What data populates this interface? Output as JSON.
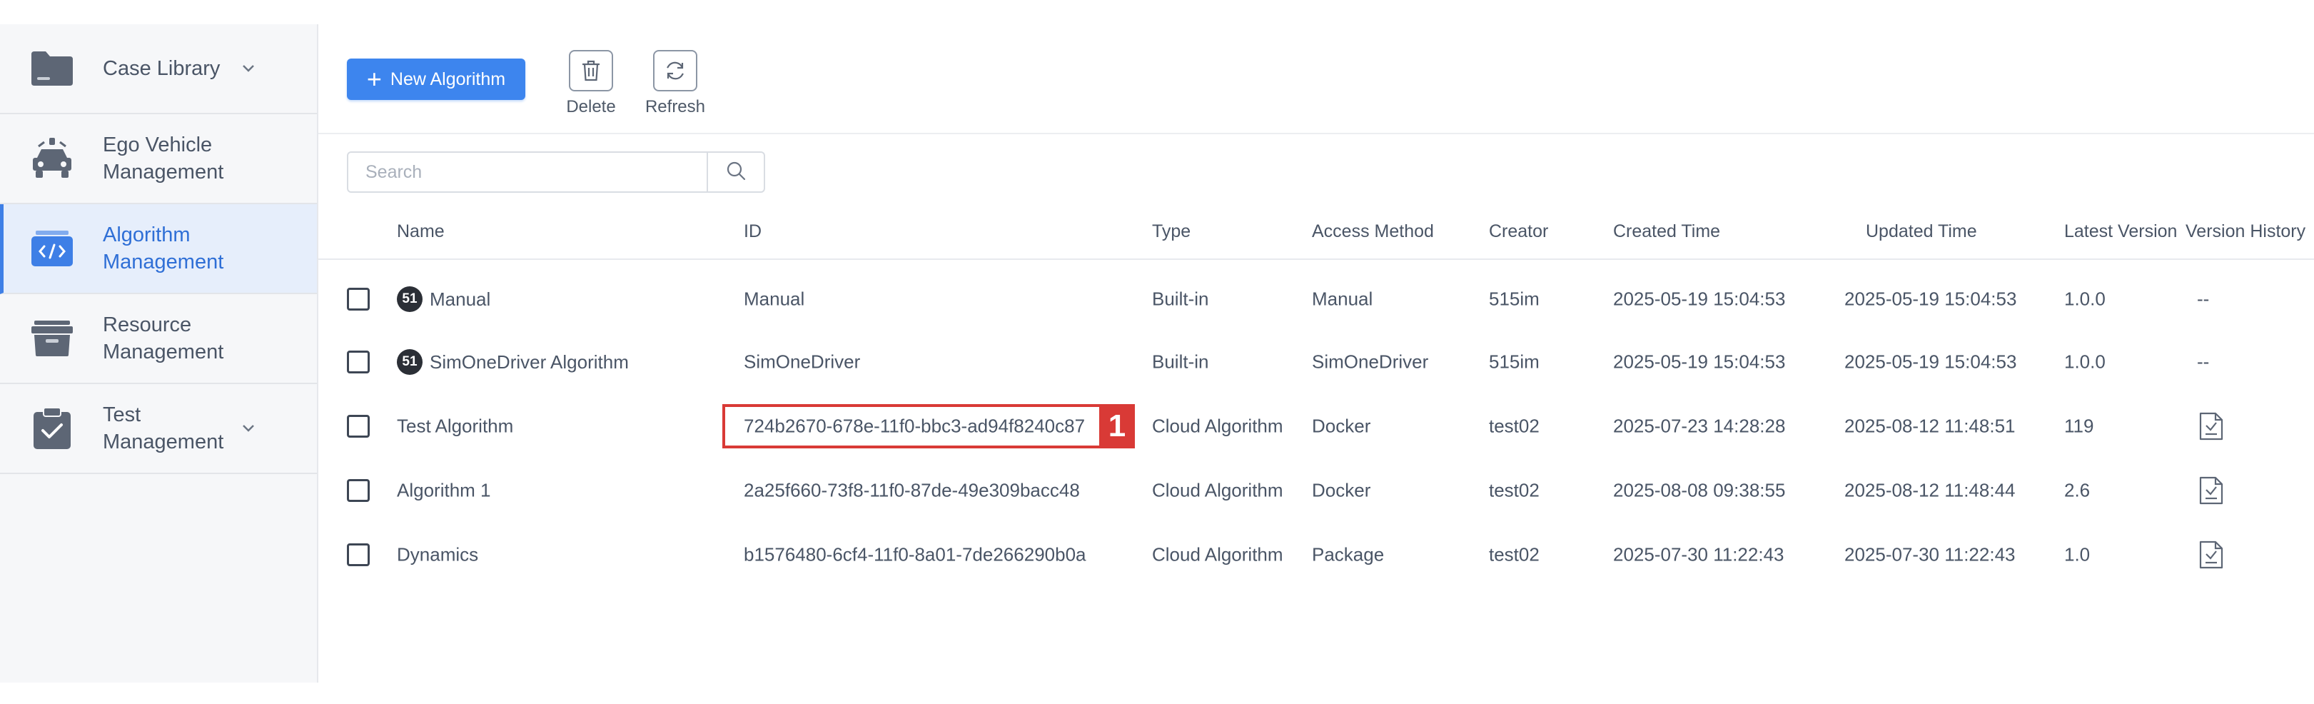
{
  "sidebar": {
    "items": [
      {
        "label": "Case Library",
        "icon": "folder-icon",
        "has_chevron": true
      },
      {
        "label": "Ego Vehicle\nManagement",
        "icon": "vehicle-icon",
        "has_chevron": false
      },
      {
        "label": "Algorithm\nManagement",
        "icon": "code-icon",
        "has_chevron": false,
        "active": true
      },
      {
        "label": "Resource\nManagement",
        "icon": "resource-box-icon",
        "has_chevron": false
      },
      {
        "label": "Test\nManagement",
        "icon": "clipboard-check-icon",
        "has_chevron": true
      }
    ]
  },
  "toolbar": {
    "new_label": "New Algorithm",
    "delete_label": "Delete",
    "refresh_label": "Refresh"
  },
  "search": {
    "placeholder": "Search",
    "value": ""
  },
  "table": {
    "headers": {
      "name": "Name",
      "id": "ID",
      "type": "Type",
      "access": "Access Method",
      "creator": "Creator",
      "created": "Created Time",
      "updated": "Updated Time",
      "latest": "Latest Version",
      "history": "Version History"
    },
    "rows": [
      {
        "badge": "51",
        "name": "Manual",
        "id": "Manual",
        "type": "Built-in",
        "access": "Manual",
        "creator": "515im",
        "created": "2025-05-19 15:04:53",
        "updated": "2025-05-19 15:04:53",
        "latest": "1.0.0",
        "history": "--"
      },
      {
        "badge": "51",
        "name": "SimOneDriver Algorithm",
        "id": "SimOneDriver",
        "type": "Built-in",
        "access": "SimOneDriver",
        "creator": "515im",
        "created": "2025-05-19 15:04:53",
        "updated": "2025-05-19 15:04:53",
        "latest": "1.0.0",
        "history": "--"
      },
      {
        "badge": "",
        "name": "Test Algorithm",
        "id": "724b2670-678e-11f0-bbc3-ad94f8240c87",
        "type": "Cloud Algorithm",
        "access": "Docker",
        "creator": "test02",
        "created": "2025-07-23 14:28:28",
        "updated": "2025-08-12 11:48:51",
        "latest": "119",
        "history": ""
      },
      {
        "badge": "",
        "name": "Algorithm 1",
        "id": "2a25f660-73f8-11f0-87de-49e309bacc48",
        "type": "Cloud Algorithm",
        "access": "Docker",
        "creator": "test02",
        "created": "2025-08-08 09:38:55",
        "updated": "2025-08-12 11:48:44",
        "latest": "2.6",
        "history": ""
      },
      {
        "badge": "",
        "name": "Dynamics",
        "id": "b1576480-6cf4-11f0-8a01-7de266290b0a",
        "type": "Cloud Algorithm",
        "access": "Package",
        "creator": "test02",
        "created": "2025-07-30 11:22:43",
        "updated": "2025-07-30 11:22:43",
        "latest": "1.0",
        "history": ""
      }
    ]
  },
  "annotation": {
    "marker_label": "1",
    "color": "#d93a36"
  },
  "colors": {
    "accent": "#3d85ee",
    "active_bg": "#e6eefb",
    "active_text": "#2f6fd6"
  }
}
